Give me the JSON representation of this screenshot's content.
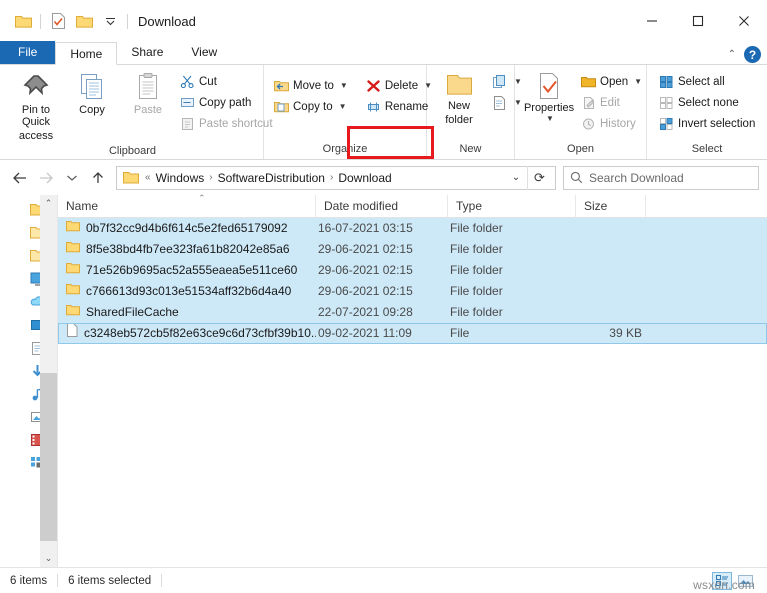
{
  "window": {
    "title": "Download",
    "quick_access": [
      "folder-icon",
      "properties-icon",
      "new-folder-icon",
      "customize-chevron-icon"
    ],
    "controls": {
      "minimize": "–",
      "maximize": "□",
      "close": "✕"
    }
  },
  "ribbon": {
    "tabs": [
      {
        "label": "File",
        "type": "file"
      },
      {
        "label": "Home",
        "type": "active"
      },
      {
        "label": "Share",
        "type": "normal"
      },
      {
        "label": "View",
        "type": "normal"
      }
    ],
    "collapse_icon": "chevron-up-icon",
    "help_icon": "?",
    "groups": [
      {
        "title": "Clipboard",
        "big": [
          {
            "label": "Pin to Quick\naccess",
            "label_l1": "Pin to Quick",
            "label_l2": "access",
            "icon": "pin-icon",
            "disabled": false
          },
          {
            "label": "Copy",
            "icon": "copy-icon",
            "disabled": false
          },
          {
            "label": "Paste",
            "icon": "paste-icon",
            "disabled": true
          }
        ],
        "small": [
          {
            "label": "Cut",
            "icon": "scissors-icon",
            "disabled": false
          },
          {
            "label": "Copy path",
            "icon": "copy-path-icon",
            "disabled": false
          },
          {
            "label": "Paste shortcut",
            "icon": "paste-shortcut-icon",
            "disabled": true
          }
        ]
      },
      {
        "title": "Organize",
        "small": [
          {
            "label": "Move to",
            "icon": "move-to-icon",
            "dropdown": true,
            "disabled": false
          },
          {
            "label": "Copy to",
            "icon": "copy-to-icon",
            "dropdown": true,
            "disabled": false
          }
        ],
        "small2": [
          {
            "label": "Delete",
            "icon": "delete-x-icon",
            "dropdown": true,
            "highlighted": true,
            "disabled": false
          },
          {
            "label": "Rename",
            "icon": "rename-icon",
            "disabled": false
          }
        ]
      },
      {
        "title": "New",
        "big": [
          {
            "label_l1": "New",
            "label_l2": "folder",
            "icon": "new-folder-icon",
            "disabled": false
          }
        ],
        "mini": [
          {
            "icon": "new-item-icon",
            "dropdown": true
          },
          {
            "icon": "easy-access-icon",
            "dropdown": true
          }
        ]
      },
      {
        "title": "Open",
        "big": [
          {
            "label_l1": "Properties",
            "label_l2": "",
            "icon": "properties-icon",
            "dropdown": true,
            "disabled": false
          }
        ],
        "small": [
          {
            "label": "Open",
            "icon": "open-folder-icon",
            "dropdown": true,
            "disabled": false
          },
          {
            "label": "Edit",
            "icon": "edit-icon",
            "disabled": true
          },
          {
            "label": "History",
            "icon": "history-icon",
            "disabled": true
          }
        ]
      },
      {
        "title": "Select",
        "small": [
          {
            "label": "Select all",
            "icon": "select-all-icon",
            "disabled": false
          },
          {
            "label": "Select none",
            "icon": "select-none-icon",
            "disabled": false
          },
          {
            "label": "Invert selection",
            "icon": "invert-selection-icon",
            "disabled": false
          }
        ]
      }
    ]
  },
  "addressbar": {
    "back_icon": "arrow-left-icon",
    "forward_icon": "arrow-right-icon",
    "recent_icon": "chevron-down-icon",
    "up_icon": "arrow-up-icon",
    "path_prefix": "«",
    "crumbs": [
      "Windows",
      "SoftwareDistribution",
      "Download"
    ],
    "separator": "›",
    "dropdown_icon": "chevron-down-icon",
    "refresh_icon": "refresh-icon",
    "search": {
      "placeholder": "Search Download",
      "icon": "search-icon",
      "value": ""
    }
  },
  "columns": [
    {
      "label": "Name",
      "sorted": "asc"
    },
    {
      "label": "Date modified"
    },
    {
      "label": "Type"
    },
    {
      "label": "Size"
    }
  ],
  "files": [
    {
      "name": "0b7f32cc9d4b6f614c5e2fed65179092",
      "date": "16-07-2021 03:15",
      "type": "File folder",
      "size": "",
      "icon": "folder-icon",
      "selected": true
    },
    {
      "name": "8f5e38bd4fb7ee323fa61b82042e85a6",
      "date": "29-06-2021 02:15",
      "type": "File folder",
      "size": "",
      "icon": "folder-icon",
      "selected": true
    },
    {
      "name": "71e526b9695ac52a555eaea5e511ce60",
      "date": "29-06-2021 02:15",
      "type": "File folder",
      "size": "",
      "icon": "folder-icon",
      "selected": true
    },
    {
      "name": "c766613d93c013e51534aff32b6d4a40",
      "date": "29-06-2021 02:15",
      "type": "File folder",
      "size": "",
      "icon": "folder-icon",
      "selected": true
    },
    {
      "name": "SharedFileCache",
      "date": "22-07-2021 09:28",
      "type": "File folder",
      "size": "",
      "icon": "folder-icon",
      "selected": true
    },
    {
      "name": "c3248eb572cb5f82e63ce9c6d73cfbf39b10...",
      "date": "09-02-2021 11:09",
      "type": "File",
      "size": "39 KB",
      "icon": "file-icon",
      "selected": true,
      "focused": true
    }
  ],
  "statusbar": {
    "item_count": "6 items",
    "selection": "6 items selected",
    "view_details_icon": "details-view-icon",
    "view_large_icon": "large-icons-view-icon"
  },
  "watermark": "wsxdn.com",
  "colors": {
    "accent": "#1b68b3",
    "highlight_box": "#e8191c",
    "selection": "#cde8f7",
    "folder": "#fbd66d"
  }
}
